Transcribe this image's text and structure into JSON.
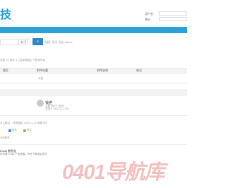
{
  "header": {
    "logo_text": "技",
    "username_label": "用户名",
    "password_label": "密码"
  },
  "search": {
    "scope": "帖子",
    "button_label": "搜索",
    "hot_label": "热搜: 活动 交友 discuz"
  },
  "meta": {
    "breadcrumb": "查看: 1 | 回复: 1 | [复制链接] | 只看该作者",
    "line2": "[复制链接]"
  },
  "table": {
    "headers": [
      "图主",
      "附件标题",
      "附件说明",
      "热点"
    ],
    "row": {
      "cell": "• 未知"
    }
  },
  "post": {
    "author": "钱老",
    "author_meta": "主题 | 帖子 | 积分",
    "author_time": "发表于 2023-11-21 07",
    "left_text": "·"
  },
  "footer": {
    "line1": "本主题由 ... 审核通过 2023-11-21 收藏 评论",
    "attach_label_a": "附件",
    "attach_label_b": "附件",
    "attach_note": "本帖附件",
    "post_title": "Email 数智化",
    "post_desc": "请查看 Email 产品提醒，有任下载地址提示"
  },
  "watermark": {
    "text": "0401导航库"
  },
  "colors": {
    "brand_blue": "#2aa2d6",
    "button_blue": "#2e86c7",
    "logo_blue": "#1a9fd9",
    "watermark": "#f0c0bf"
  }
}
